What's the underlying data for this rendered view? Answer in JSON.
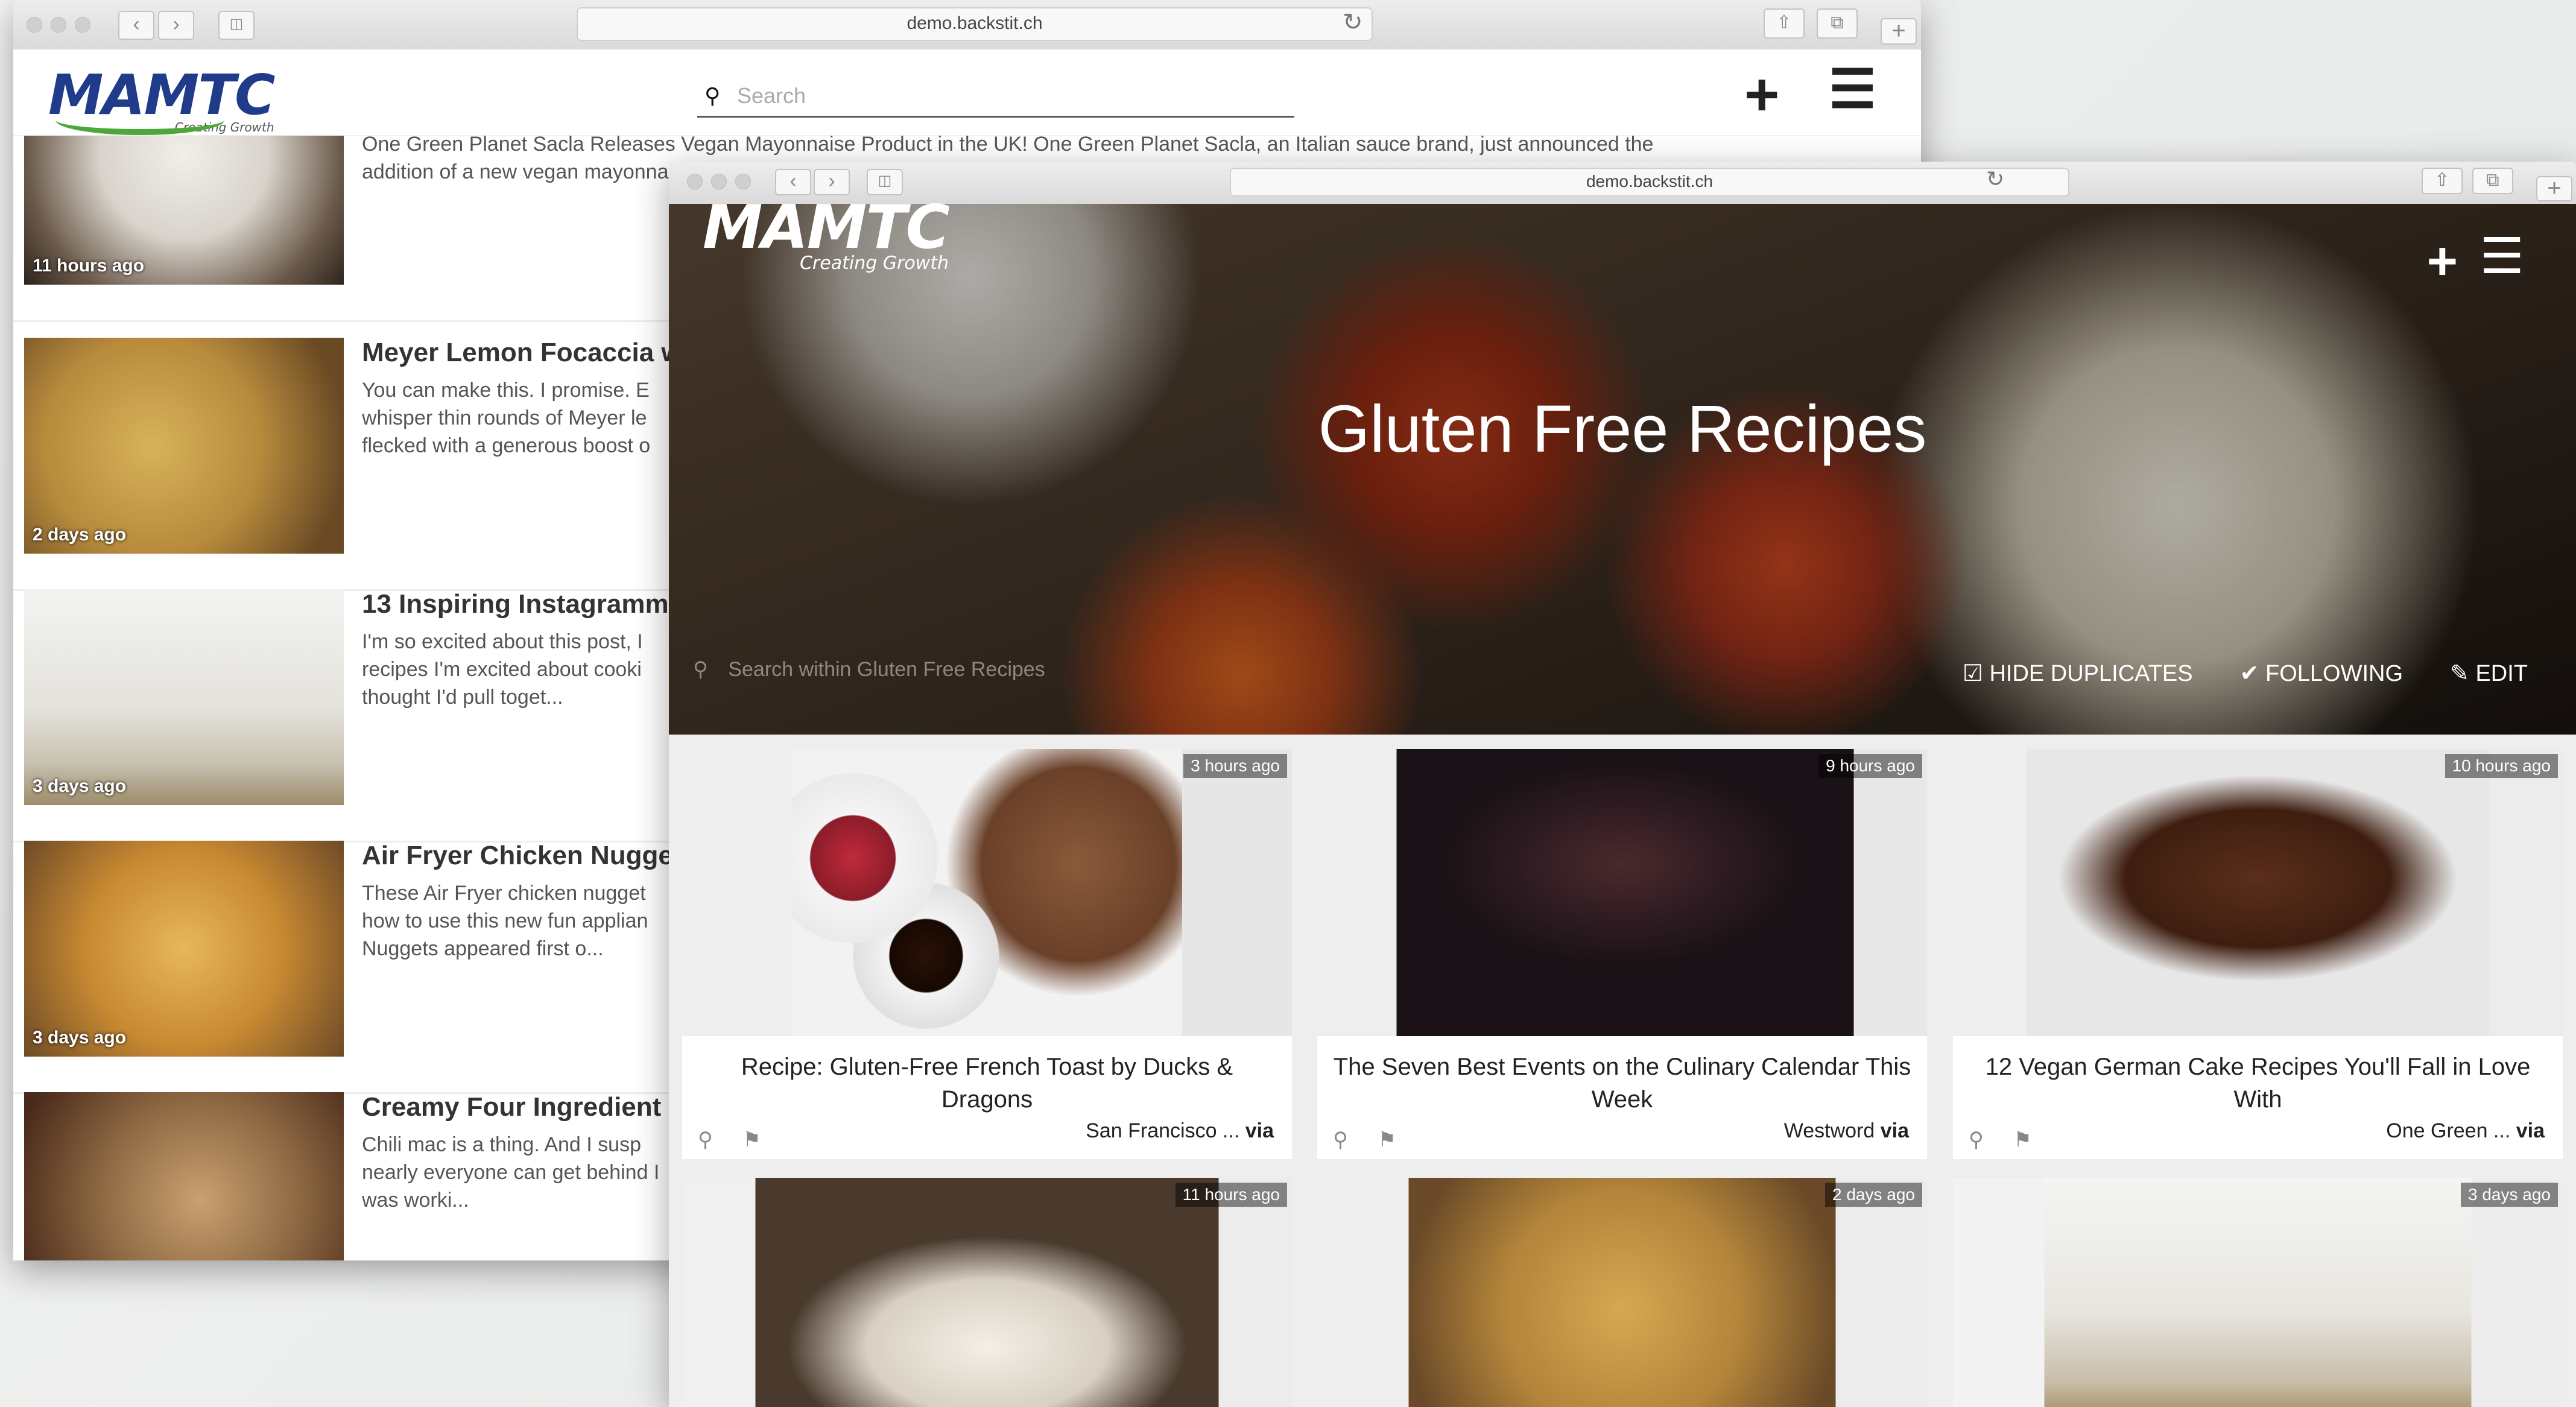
{
  "back_window": {
    "url": "demo.backstit.ch",
    "logo": {
      "name": "MAMTC",
      "tagline": "Creating Growth"
    },
    "search_placeholder": "Search",
    "articles": [
      {
        "title": "",
        "summary": "One Green Planet Sacla Releases Vegan Mayonnaise Product in the UK! One Green Planet Sacla, an Italian sauce brand, just announced the addition of a new vegan mayonnaise product to be released in supermarkets across the UK like Sainsburys, Co-op, and Ocado. Sacla is w...",
        "age": "11 hours ago"
      },
      {
        "title": "Meyer Lemon Focaccia w",
        "summary": "You can make this. I promise. E whisper thin rounds of Meyer le flecked with a generous boost o",
        "age": "2 days ago"
      },
      {
        "title": "13 Inspiring Instagramm",
        "summary": "I'm so excited about this post, I recipes I'm excited about cooki thought I'd pull toget...",
        "age": "3 days ago"
      },
      {
        "title": "Air Fryer Chicken Nugget",
        "summary": "These Air Fryer chicken nugget how to use this new fun applian Nuggets appeared first o...",
        "age": "3 days ago"
      },
      {
        "title": "Creamy Four Ingredient C",
        "summary": "Chili mac is a thing. And I susp nearly everyone can get behind I was worki...",
        "age": ""
      }
    ]
  },
  "front_window": {
    "url": "demo.backstit.ch",
    "logo": {
      "name": "MAMTC",
      "tagline": "Creating Growth"
    },
    "title": "Gluten Free Recipes",
    "search_placeholder": "Search within Gluten Free Recipes",
    "actions": {
      "hide_duplicates": "HIDE DUPLICATES",
      "following": "FOLLOWING",
      "edit": "EDIT"
    },
    "cards": [
      {
        "age": "3 hours ago",
        "title": "Recipe: Gluten-Free French Toast by Ducks & Dragons",
        "source": "San Francisco ...",
        "via": "via"
      },
      {
        "age": "9 hours ago",
        "title": "The Seven Best Events on the Culinary Calendar This Week",
        "source": "Westword",
        "via": "via"
      },
      {
        "age": "10 hours ago",
        "title": "12 Vegan German Cake Recipes You'll Fall in Love With",
        "source": "One Green ...",
        "via": "via"
      },
      {
        "age": "11 hours ago",
        "title": "",
        "source": "",
        "via": ""
      },
      {
        "age": "2 days ago",
        "title": "",
        "source": "",
        "via": ""
      },
      {
        "age": "3 days ago",
        "title": "",
        "source": "",
        "via": ""
      }
    ]
  },
  "colors": {
    "logo_blue": "#1f3b8a",
    "logo_green": "#4ca83a"
  }
}
